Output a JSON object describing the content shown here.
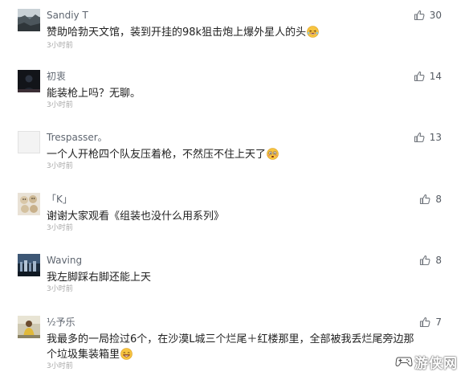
{
  "comments": [
    {
      "user": "Sandiy T",
      "text": "赞助哈勃天文馆，装到开挂的98k狙击炮上爆外星人的头",
      "emoji": "laughing-emoji",
      "time": "3小时前",
      "likes": "30"
    },
    {
      "user": "初衷",
      "text": "能装枪上吗？无聊。",
      "time": "3小时前",
      "likes": "14"
    },
    {
      "user": "Trespasser。",
      "text": "一个人开枪四个队友压着枪，不然压不住上天了",
      "emoji": "flushed-emoji",
      "time": "3小时前",
      "likes": "13"
    },
    {
      "user": "「K」",
      "text": "谢谢大家观看《组装也没什么用系列》",
      "time": "3小时前",
      "likes": "8"
    },
    {
      "user": "Waving",
      "text": "我左脚踩右脚还能上天",
      "time": "3小时前",
      "likes": "8"
    },
    {
      "user": "½予乐",
      "text": "我最多的一局捡过6个，在沙漠L城三个烂尾＋红楼那里，全部被我丢烂尾旁边那个垃圾集装箱里",
      "emoji": "grinning-emoji",
      "time": "3小时前",
      "likes": "7"
    }
  ],
  "watermark": {
    "text": "游侠网",
    "icon": "game-controller-logo"
  },
  "colors": {
    "username": "#5f6670",
    "comment_text": "#222222",
    "timestamp": "#a8a8a8",
    "like_icon": "#72777e"
  }
}
